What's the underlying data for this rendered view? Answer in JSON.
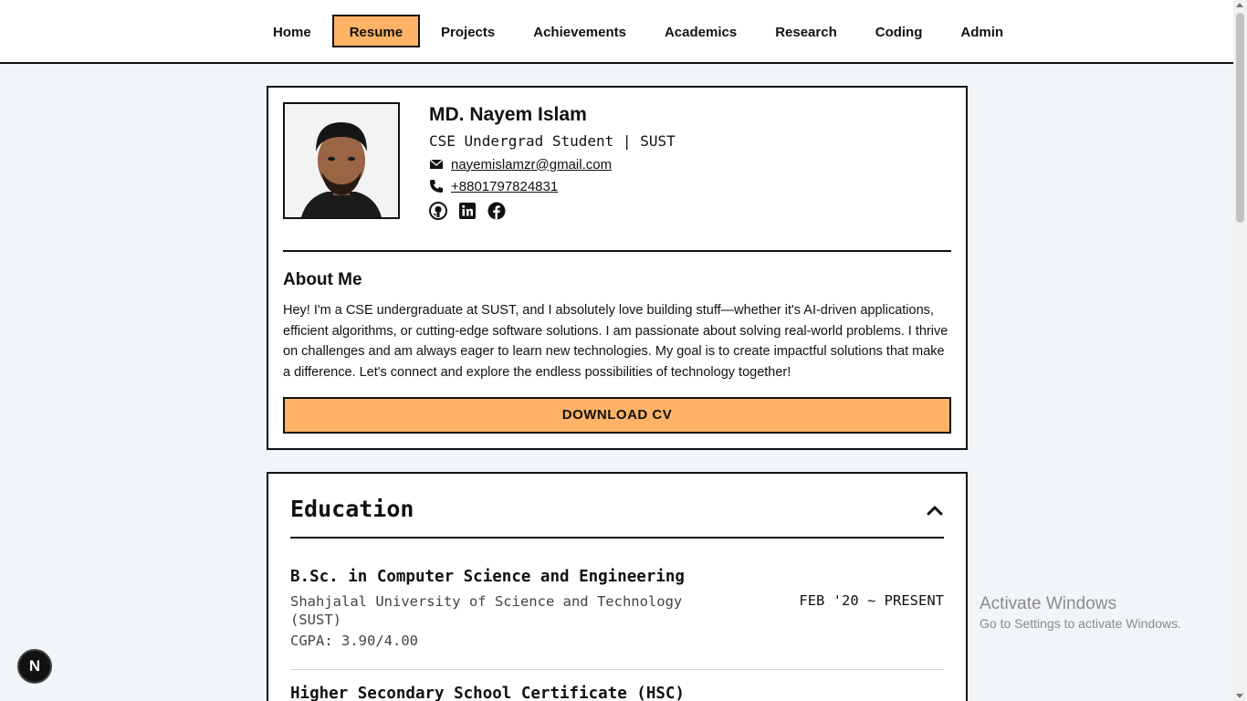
{
  "nav": {
    "items": [
      {
        "label": "Home",
        "active": false
      },
      {
        "label": "Resume",
        "active": true
      },
      {
        "label": "Projects",
        "active": false
      },
      {
        "label": "Achievements",
        "active": false
      },
      {
        "label": "Academics",
        "active": false
      },
      {
        "label": "Research",
        "active": false
      },
      {
        "label": "Coding",
        "active": false
      },
      {
        "label": "Admin",
        "active": false
      }
    ],
    "accent_color": "#ffb366"
  },
  "profile": {
    "name": "MD. Nayem Islam",
    "tagline": "CSE Undergrad Student | SUST",
    "email": "nayemislamzr@gmail.com",
    "phone": "+8801797824831",
    "socials": [
      "github-icon",
      "linkedin-icon",
      "facebook-icon"
    ],
    "about_title": "About Me",
    "about_text": "Hey! I'm a CSE undergraduate at SUST, and I absolutely love building stuff—whether it's AI-driven applications, efficient algorithms, or cutting-edge software solutions. I am passionate about solving real-world problems. I thrive on challenges and am always eager to learn new technologies. My goal is to create impactful solutions that make a difference. Let's connect and explore the endless possibilities of technology together!",
    "download_label": "DOWNLOAD CV"
  },
  "education": {
    "title": "Education",
    "entries": [
      {
        "degree": "B.Sc. in Computer Science and Engineering",
        "school": "Shahjalal University of Science and Technology (SUST)",
        "period": "FEB '20 ~ PRESENT",
        "gpa": "CGPA: 3.90/4.00"
      },
      {
        "degree": "Higher Secondary School Certificate (HSC)"
      }
    ]
  },
  "watermark": {
    "title": "Activate Windows",
    "subtitle": "Go to Settings to activate Windows."
  },
  "dev_badge": "N"
}
